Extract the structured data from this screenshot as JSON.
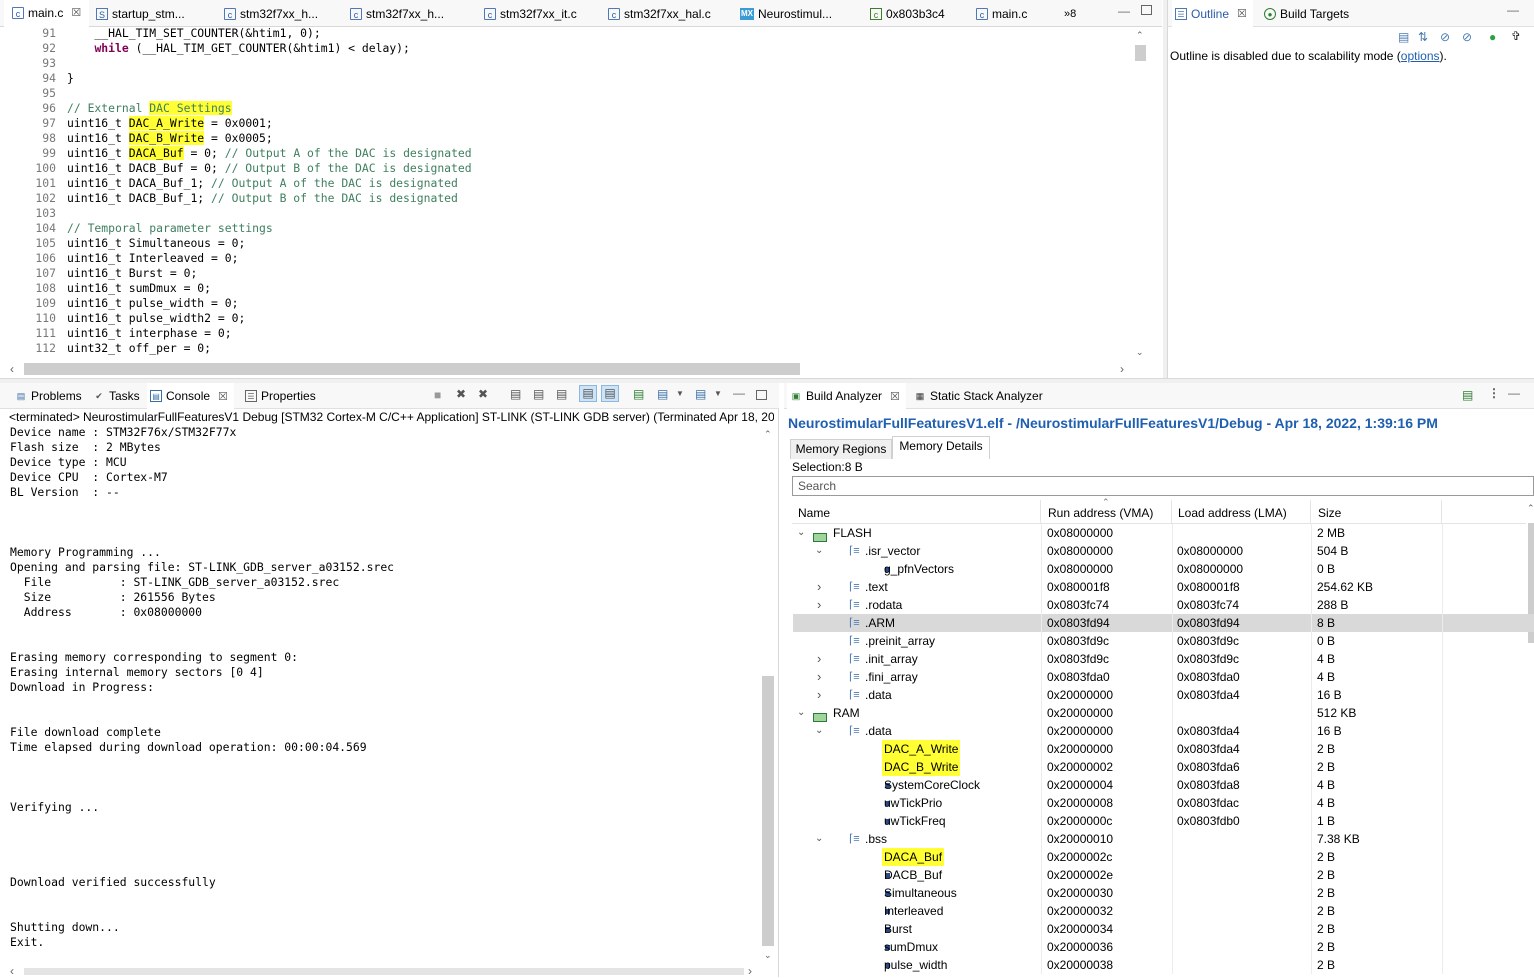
{
  "editor": {
    "tabs": [
      {
        "label": "main.c",
        "icon": "c-file-icon",
        "active": true
      },
      {
        "label": "startup_stm...",
        "icon": "s-file-icon"
      },
      {
        "label": "stm32f7xx_h...",
        "icon": "c-file-icon"
      },
      {
        "label": "stm32f7xx_h...",
        "icon": "c-file-icon"
      },
      {
        "label": "stm32f7xx_it.c",
        "icon": "c-file-icon"
      },
      {
        "label": "stm32f7xx_hal.c",
        "icon": "c-file-icon"
      },
      {
        "label": "Neurostimul...",
        "icon": "mx-icon"
      },
      {
        "label": "0x803b3c4",
        "icon": "hex-file-icon"
      },
      {
        "label": "main.c",
        "icon": "c-file-icon"
      }
    ],
    "overflow_label": "»8",
    "mx_icon_text": "MX",
    "lines": [
      {
        "n": "91",
        "code": "    __HAL_TIM_SET_COUNTER(&htim1, 0);"
      },
      {
        "n": "92",
        "code": "    while (__HAL_TIM_GET_COUNTER(&htim1) < delay);"
      },
      {
        "n": "93",
        "code": ""
      },
      {
        "n": "94",
        "code": "}"
      },
      {
        "n": "95",
        "code": ""
      },
      {
        "n": "96",
        "code": "// External DAC Settings"
      },
      {
        "n": "97",
        "code": "uint16_t DAC_A_Write = 0x0001;"
      },
      {
        "n": "98",
        "code": "uint16_t DAC_B_Write = 0x0005;"
      },
      {
        "n": "99",
        "code": "uint16_t DACA_Buf = 0; // Output A of the DAC is designated"
      },
      {
        "n": "100",
        "code": "uint16_t DACB_Buf = 0; // Output B of the DAC is designated"
      },
      {
        "n": "101",
        "code": "uint16_t DACA_Buf_1; // Output A of the DAC is designated"
      },
      {
        "n": "102",
        "code": "uint16_t DACB_Buf_1; // Output B of the DAC is designated"
      },
      {
        "n": "103",
        "code": ""
      },
      {
        "n": "104",
        "code": "// Temporal parameter settings"
      },
      {
        "n": "105",
        "code": "uint16_t Simultaneous = 0;"
      },
      {
        "n": "106",
        "code": "uint16_t Interleaved = 0;"
      },
      {
        "n": "107",
        "code": "uint16_t Burst = 0;"
      },
      {
        "n": "108",
        "code": "uint16_t sumDmux = 0;"
      },
      {
        "n": "109",
        "code": "uint16_t pulse_width = 0;"
      },
      {
        "n": "110",
        "code": "uint16_t pulse_width2 = 0;"
      },
      {
        "n": "111",
        "code": "uint16_t interphase = 0;"
      },
      {
        "n": "112",
        "code": "uint32_t off_per = 0;"
      }
    ],
    "highlights": [
      "DAC_A_Write",
      "DAC_B_Write",
      "DACA_Buf"
    ],
    "keyword": "while"
  },
  "outline": {
    "tabs": [
      {
        "label": "Outline",
        "icon": "outline-icon",
        "active": true
      },
      {
        "label": "Build Targets",
        "icon": "build-targets-icon"
      }
    ],
    "message_prefix": "Outline is disabled due to scalability mode (",
    "message_link": "options",
    "message_suffix": ")."
  },
  "console": {
    "tabs": [
      {
        "label": "Problems",
        "icon": "problems-icon"
      },
      {
        "label": "Tasks",
        "icon": "tasks-icon"
      },
      {
        "label": "Console",
        "icon": "console-icon",
        "active": true
      },
      {
        "label": "Properties",
        "icon": "properties-icon"
      }
    ],
    "header": "<terminated> NeurostimularFullFeaturesV1 Debug [STM32 Cortex-M C/C++ Application] ST-LINK (ST-LINK GDB server) (Terminated Apr 18, 2022,",
    "lines": [
      "Device name : STM32F76x/STM32F77x",
      "Flash size  : 2 MBytes",
      "Device type : MCU",
      "Device CPU  : Cortex-M7",
      "BL Version  : --",
      "",
      "",
      "",
      "Memory Programming ...",
      "Opening and parsing file: ST-LINK_GDB_server_a03152.srec",
      "  File          : ST-LINK_GDB_server_a03152.srec",
      "  Size          : 261556 Bytes",
      "  Address       : 0x08000000",
      "",
      "",
      "Erasing memory corresponding to segment 0:",
      "Erasing internal memory sectors [0 4]",
      "Download in Progress:",
      "",
      "",
      "File download complete",
      "Time elapsed during download operation: 00:00:04.569",
      "",
      "",
      "",
      "Verifying ...",
      "",
      "",
      "",
      "",
      "Download verified successfully",
      "",
      "",
      "Shutting down...",
      "Exit."
    ]
  },
  "build_analyzer": {
    "tabs": [
      {
        "label": "Build Analyzer",
        "icon": "build-analyzer-icon",
        "active": true
      },
      {
        "label": "Static Stack Analyzer",
        "icon": "stack-analyzer-icon"
      }
    ],
    "title": "NeurostimularFullFeaturesV1.elf - /NeurostimularFullFeaturesV1/Debug - Apr 18, 2022, 1:39:16 PM",
    "subtabs": [
      {
        "label": "Memory Regions"
      },
      {
        "label": "Memory Details",
        "active": true
      }
    ],
    "selection": "Selection:8 B",
    "search_placeholder": "Search",
    "columns": [
      "Name",
      "Run address (VMA)",
      "Load address (LMA)",
      "Size"
    ],
    "rows": [
      {
        "level": 0,
        "toggle": "open",
        "kind": "region",
        "name": "FLASH",
        "vma": "0x08000000",
        "lma": "",
        "size": "2 MB"
      },
      {
        "level": 1,
        "toggle": "open",
        "kind": "section",
        "name": ".isr_vector",
        "vma": "0x08000000",
        "lma": "0x08000000",
        "size": "504 B"
      },
      {
        "level": 2,
        "toggle": "",
        "kind": "symbol",
        "name": "g_pfnVectors",
        "vma": "0x08000000",
        "lma": "0x08000000",
        "size": "0 B"
      },
      {
        "level": 1,
        "toggle": "closed",
        "kind": "section",
        "name": ".text",
        "vma": "0x080001f8",
        "lma": "0x080001f8",
        "size": "254.62 KB"
      },
      {
        "level": 1,
        "toggle": "closed",
        "kind": "section",
        "name": ".rodata",
        "vma": "0x0803fc74",
        "lma": "0x0803fc74",
        "size": "288 B"
      },
      {
        "level": 1,
        "toggle": "",
        "kind": "section",
        "name": ".ARM",
        "vma": "0x0803fd94",
        "lma": "0x0803fd94",
        "size": "8 B",
        "selected": true
      },
      {
        "level": 1,
        "toggle": "",
        "kind": "section",
        "name": ".preinit_array",
        "vma": "0x0803fd9c",
        "lma": "0x0803fd9c",
        "size": "0 B"
      },
      {
        "level": 1,
        "toggle": "closed",
        "kind": "section",
        "name": ".init_array",
        "vma": "0x0803fd9c",
        "lma": "0x0803fd9c",
        "size": "4 B"
      },
      {
        "level": 1,
        "toggle": "closed",
        "kind": "section",
        "name": ".fini_array",
        "vma": "0x0803fda0",
        "lma": "0x0803fda0",
        "size": "4 B"
      },
      {
        "level": 1,
        "toggle": "closed",
        "kind": "section",
        "name": ".data",
        "vma": "0x20000000",
        "lma": "0x0803fda4",
        "size": "16 B"
      },
      {
        "level": 0,
        "toggle": "open",
        "kind": "region",
        "name": "RAM",
        "vma": "0x20000000",
        "lma": "",
        "size": "512 KB"
      },
      {
        "level": 1,
        "toggle": "open",
        "kind": "section",
        "name": ".data",
        "vma": "0x20000000",
        "lma": "0x0803fda4",
        "size": "16 B"
      },
      {
        "level": 2,
        "toggle": "",
        "kind": "symbol",
        "name": "DAC_A_Write",
        "vma": "0x20000000",
        "lma": "0x0803fda4",
        "size": "2 B",
        "highlight": true
      },
      {
        "level": 2,
        "toggle": "",
        "kind": "symbol",
        "name": "DAC_B_Write",
        "vma": "0x20000002",
        "lma": "0x0803fda6",
        "size": "2 B",
        "highlight": true
      },
      {
        "level": 2,
        "toggle": "",
        "kind": "symbol",
        "name": "SystemCoreClock",
        "vma": "0x20000004",
        "lma": "0x0803fda8",
        "size": "4 B"
      },
      {
        "level": 2,
        "toggle": "",
        "kind": "symbol",
        "name": "uwTickPrio",
        "vma": "0x20000008",
        "lma": "0x0803fdac",
        "size": "4 B"
      },
      {
        "level": 2,
        "toggle": "",
        "kind": "symbol",
        "name": "uwTickFreq",
        "vma": "0x2000000c",
        "lma": "0x0803fdb0",
        "size": "1 B"
      },
      {
        "level": 1,
        "toggle": "open",
        "kind": "section",
        "name": ".bss",
        "vma": "0x20000010",
        "lma": "",
        "size": "7.38 KB"
      },
      {
        "level": 2,
        "toggle": "",
        "kind": "symbol",
        "name": "DACA_Buf",
        "vma": "0x2000002c",
        "lma": "",
        "size": "2 B",
        "highlight": true
      },
      {
        "level": 2,
        "toggle": "",
        "kind": "symbol",
        "name": "DACB_Buf",
        "vma": "0x2000002e",
        "lma": "",
        "size": "2 B"
      },
      {
        "level": 2,
        "toggle": "",
        "kind": "symbol",
        "name": "Simultaneous",
        "vma": "0x20000030",
        "lma": "",
        "size": "2 B"
      },
      {
        "level": 2,
        "toggle": "",
        "kind": "symbol",
        "name": "Interleaved",
        "vma": "0x20000032",
        "lma": "",
        "size": "2 B"
      },
      {
        "level": 2,
        "toggle": "",
        "kind": "symbol",
        "name": "Burst",
        "vma": "0x20000034",
        "lma": "",
        "size": "2 B"
      },
      {
        "level": 2,
        "toggle": "",
        "kind": "symbol",
        "name": "sumDmux",
        "vma": "0x20000036",
        "lma": "",
        "size": "2 B"
      },
      {
        "level": 2,
        "toggle": "",
        "kind": "symbol",
        "name": "pulse_width",
        "vma": "0x20000038",
        "lma": "",
        "size": "2 B"
      }
    ]
  },
  "colors": {
    "highlight": "#ffff33",
    "comment": "#3f7f5f",
    "keyword": "#7f0055",
    "link": "#1f5fb0",
    "title": "#1f5fb0",
    "selected_row": "#d9d9d9"
  }
}
